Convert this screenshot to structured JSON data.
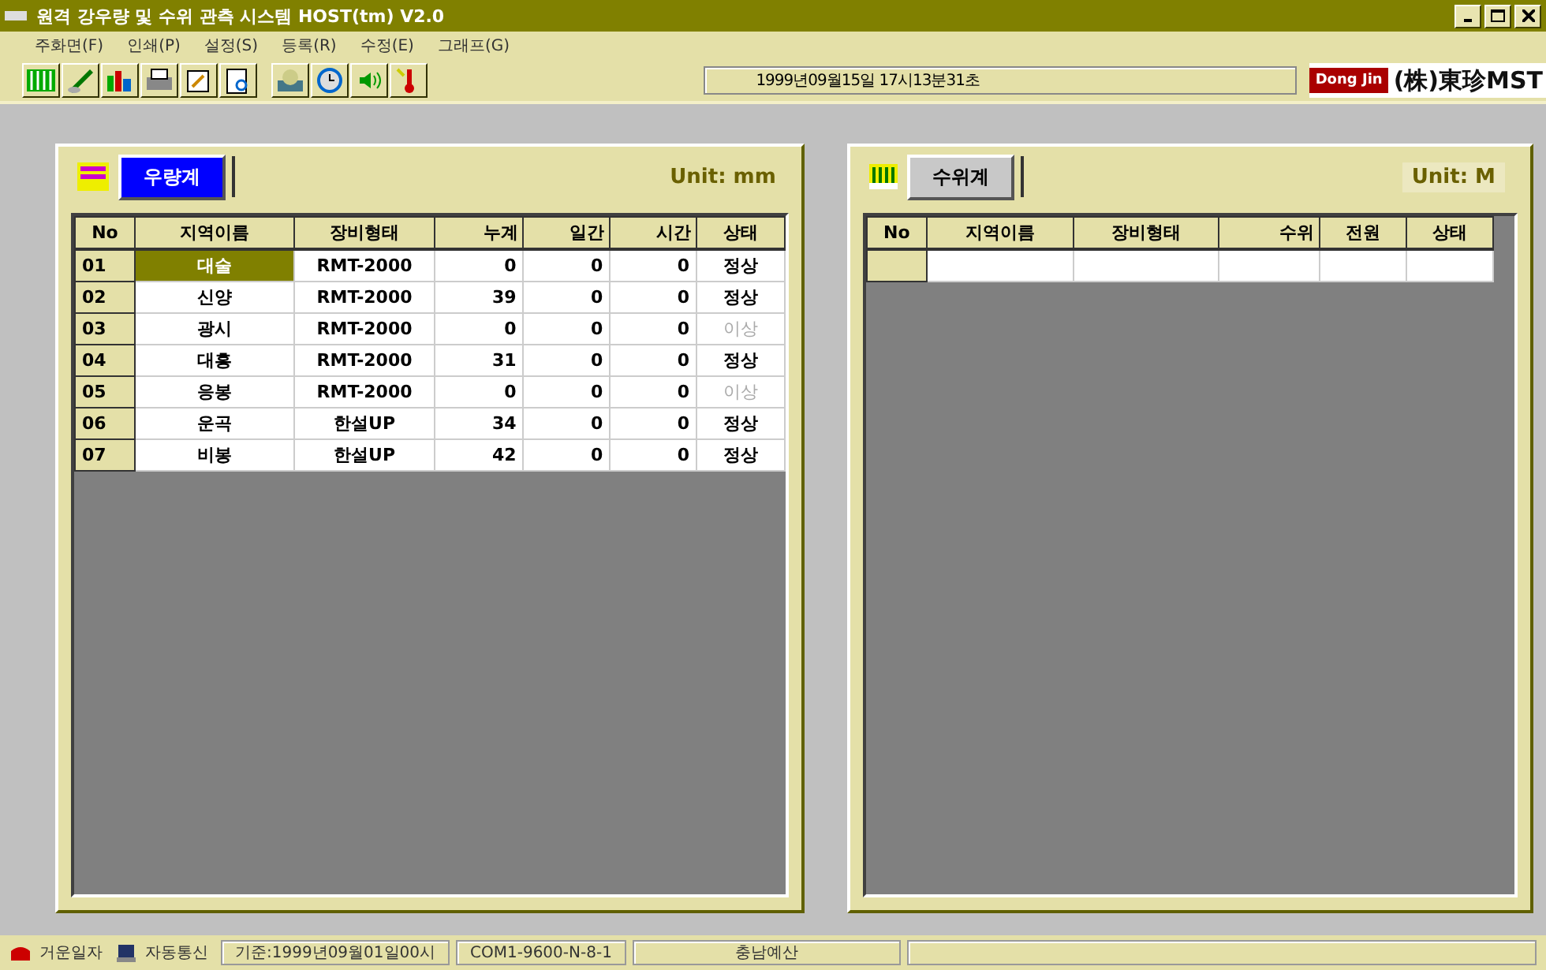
{
  "window": {
    "title": "원격 강우량 및 수위 관측 시스템 HOST(tm) V2.0"
  },
  "menu": [
    "주화면(F)",
    "인쇄(P)",
    "설정(S)",
    "등록(R)",
    "수정(E)",
    "그래프(G)"
  ],
  "toolbar": [
    {
      "kind": "bars"
    },
    {
      "kind": "pen"
    },
    {
      "kind": "chart"
    },
    {
      "kind": "printer"
    },
    {
      "kind": "edit"
    },
    {
      "kind": "preview"
    },
    {
      "kind": "phone"
    },
    {
      "kind": "clock"
    },
    {
      "kind": "speaker"
    },
    {
      "kind": "thermometer"
    }
  ],
  "clock": "1999년09월15일  17시13분31초",
  "logo": {
    "badge": "Dong Jin",
    "text": "(株)東珍MST"
  },
  "rain": {
    "tab": "우량계",
    "unit": "Unit: mm",
    "columns": [
      "No",
      "지역이름",
      "장비형태",
      "누계",
      "일간",
      "시간",
      "상태"
    ],
    "rows": [
      {
        "no": "01",
        "name": "대술",
        "device": "RMT-2000",
        "total": "0",
        "daily": "0",
        "hourly": "0",
        "status": "정상",
        "alarm": false,
        "selected": true
      },
      {
        "no": "02",
        "name": "신양",
        "device": "RMT-2000",
        "total": "39",
        "daily": "0",
        "hourly": "0",
        "status": "정상",
        "alarm": false,
        "selected": false
      },
      {
        "no": "03",
        "name": "광시",
        "device": "RMT-2000",
        "total": "0",
        "daily": "0",
        "hourly": "0",
        "status": "이상",
        "alarm": true,
        "selected": false
      },
      {
        "no": "04",
        "name": "대흥",
        "device": "RMT-2000",
        "total": "31",
        "daily": "0",
        "hourly": "0",
        "status": "정상",
        "alarm": false,
        "selected": false
      },
      {
        "no": "05",
        "name": "응봉",
        "device": "RMT-2000",
        "total": "0",
        "daily": "0",
        "hourly": "0",
        "status": "이상",
        "alarm": true,
        "selected": false
      },
      {
        "no": "06",
        "name": "운곡",
        "device": "한설UP",
        "total": "34",
        "daily": "0",
        "hourly": "0",
        "status": "정상",
        "alarm": false,
        "selected": false
      },
      {
        "no": "07",
        "name": "비봉",
        "device": "한설UP",
        "total": "42",
        "daily": "0",
        "hourly": "0",
        "status": "정상",
        "alarm": false,
        "selected": false
      }
    ]
  },
  "level": {
    "tab": "수위계",
    "unit": "Unit: M",
    "columns": [
      "No",
      "지역이름",
      "장비형태",
      "수위",
      "전원",
      "상태"
    ]
  },
  "status_bar": [
    {
      "kind": "icon",
      "text": "거운일자"
    },
    {
      "kind": "icon",
      "text": "자동통신"
    },
    {
      "kind": "field",
      "text": "기준:1999년09월01일00시"
    },
    {
      "kind": "field",
      "text": "COM1-9600-N-8-1"
    },
    {
      "kind": "field",
      "text": "충남예산"
    }
  ]
}
